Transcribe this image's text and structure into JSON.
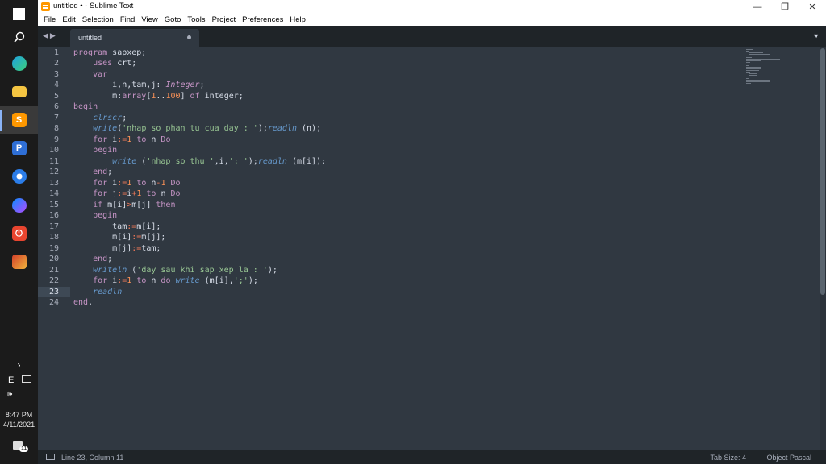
{
  "window": {
    "title": "untitled • - Sublime Text"
  },
  "menu": [
    {
      "mnemonic": "F",
      "rest": "ile"
    },
    {
      "mnemonic": "E",
      "rest": "dit"
    },
    {
      "mnemonic": "S",
      "rest": "election"
    },
    {
      "lead": "F",
      "mnemonic": "i",
      "rest": "nd"
    },
    {
      "mnemonic": "V",
      "rest": "iew"
    },
    {
      "mnemonic": "G",
      "rest": "oto"
    },
    {
      "mnemonic": "T",
      "rest": "ools"
    },
    {
      "mnemonic": "P",
      "rest": "roject"
    },
    {
      "lead": "Prefere",
      "mnemonic": "n",
      "rest": "ces"
    },
    {
      "mnemonic": "H",
      "rest": "elp"
    }
  ],
  "tab": {
    "title": "untitled",
    "dirty": true
  },
  "editor": {
    "current_line": 23,
    "lines": [
      [
        [
          "program",
          "k"
        ],
        [
          " sapxep;",
          ""
        ]
      ],
      [
        [
          "    uses",
          "k"
        ],
        [
          " crt;",
          ""
        ]
      ],
      [
        [
          "    var",
          "k"
        ]
      ],
      [
        [
          "        i,n,tam,j: ",
          ""
        ],
        [
          "Integer",
          "it"
        ],
        [
          ";",
          ""
        ]
      ],
      [
        [
          "        m",
          ""
        ],
        [
          ":",
          ""
        ],
        [
          "array",
          "k"
        ],
        [
          "[",
          ""
        ],
        [
          "1",
          "n"
        ],
        [
          "..",
          ""
        ],
        [
          "100",
          "n"
        ],
        [
          "] ",
          ""
        ],
        [
          "of",
          "k"
        ],
        [
          " integer;",
          ""
        ]
      ],
      [
        [
          "begin",
          "k"
        ]
      ],
      [
        [
          "    ",
          ""
        ],
        [
          "clrscr",
          "f"
        ],
        [
          ";",
          ""
        ]
      ],
      [
        [
          "    ",
          ""
        ],
        [
          "write",
          "f"
        ],
        [
          "(",
          ""
        ],
        [
          "'nhap so phan tu cua day : '",
          "s"
        ],
        [
          ");",
          ""
        ],
        [
          "readln",
          "f"
        ],
        [
          " (n);",
          ""
        ]
      ],
      [
        [
          "    ",
          ""
        ],
        [
          "for",
          "k"
        ],
        [
          " i",
          ""
        ],
        [
          ":=",
          "o"
        ],
        [
          "1",
          "n"
        ],
        [
          " ",
          ""
        ],
        [
          "to",
          "k"
        ],
        [
          " n ",
          ""
        ],
        [
          "Do",
          "k"
        ]
      ],
      [
        [
          "    ",
          ""
        ],
        [
          "begin",
          "k"
        ]
      ],
      [
        [
          "        ",
          ""
        ],
        [
          "write",
          "f"
        ],
        [
          " (",
          ""
        ],
        [
          "'nhap so thu '",
          "s"
        ],
        [
          ",i,",
          ""
        ],
        [
          "': '",
          "s"
        ],
        [
          ");",
          ""
        ],
        [
          "readln",
          "f"
        ],
        [
          " (m[i]);",
          ""
        ]
      ],
      [
        [
          "    ",
          ""
        ],
        [
          "end",
          "k"
        ],
        [
          ";",
          ""
        ]
      ],
      [
        [
          "    ",
          ""
        ],
        [
          "for",
          "k"
        ],
        [
          " i",
          ""
        ],
        [
          ":=",
          "o"
        ],
        [
          "1",
          "n"
        ],
        [
          " ",
          ""
        ],
        [
          "to",
          "k"
        ],
        [
          " n",
          ""
        ],
        [
          "-",
          "o"
        ],
        [
          "1",
          "n"
        ],
        [
          " ",
          ""
        ],
        [
          "Do",
          "k"
        ]
      ],
      [
        [
          "    ",
          ""
        ],
        [
          "for",
          "k"
        ],
        [
          " j",
          ""
        ],
        [
          ":=",
          "o"
        ],
        [
          "i",
          ""
        ],
        [
          "+",
          "o"
        ],
        [
          "1",
          "n"
        ],
        [
          " ",
          ""
        ],
        [
          "to",
          "k"
        ],
        [
          " n ",
          ""
        ],
        [
          "Do",
          "k"
        ]
      ],
      [
        [
          "    ",
          ""
        ],
        [
          "if",
          "k"
        ],
        [
          " m[i]",
          ""
        ],
        [
          ">",
          "o"
        ],
        [
          "m[j] ",
          ""
        ],
        [
          "then",
          "k"
        ]
      ],
      [
        [
          "    ",
          ""
        ],
        [
          "begin",
          "k"
        ]
      ],
      [
        [
          "        tam",
          ""
        ],
        [
          ":=",
          "o"
        ],
        [
          "m[i];",
          ""
        ]
      ],
      [
        [
          "        m[i]",
          ""
        ],
        [
          ":=",
          "o"
        ],
        [
          "m[j];",
          ""
        ]
      ],
      [
        [
          "        m[j]",
          ""
        ],
        [
          ":=",
          "o"
        ],
        [
          "tam;",
          ""
        ]
      ],
      [
        [
          "    ",
          ""
        ],
        [
          "end",
          "k"
        ],
        [
          ";",
          ""
        ]
      ],
      [
        [
          "    ",
          ""
        ],
        [
          "writeln",
          "f"
        ],
        [
          " (",
          ""
        ],
        [
          "'day sau khi sap xep la : '",
          "s"
        ],
        [
          ");",
          ""
        ]
      ],
      [
        [
          "    ",
          ""
        ],
        [
          "for",
          "k"
        ],
        [
          " i",
          ""
        ],
        [
          ":=",
          "o"
        ],
        [
          "1",
          "n"
        ],
        [
          " ",
          ""
        ],
        [
          "to",
          "k"
        ],
        [
          " n ",
          ""
        ],
        [
          "do",
          "k"
        ],
        [
          " ",
          ""
        ],
        [
          "write",
          "f"
        ],
        [
          " (m[i],",
          ""
        ],
        [
          "';'",
          "s"
        ],
        [
          ");",
          ""
        ]
      ],
      [
        [
          "    ",
          ""
        ],
        [
          "readln",
          "f"
        ]
      ],
      [
        [
          "end",
          "k"
        ],
        [
          ".",
          ""
        ]
      ]
    ]
  },
  "status": {
    "position": "Line 23, Column 11",
    "tab_size": "Tab Size: 4",
    "syntax": "Object Pascal"
  },
  "taskbar": {
    "time": "8:47 PM",
    "date": "4/11/2021",
    "lang": "E",
    "notification_count": "11"
  },
  "colors": {
    "background": "#303841",
    "keyword": "#c594c5",
    "string": "#99c794",
    "function": "#6699cc",
    "number": "#f99157",
    "operator": "#f97b58",
    "gutter_text": "#a7adba"
  }
}
